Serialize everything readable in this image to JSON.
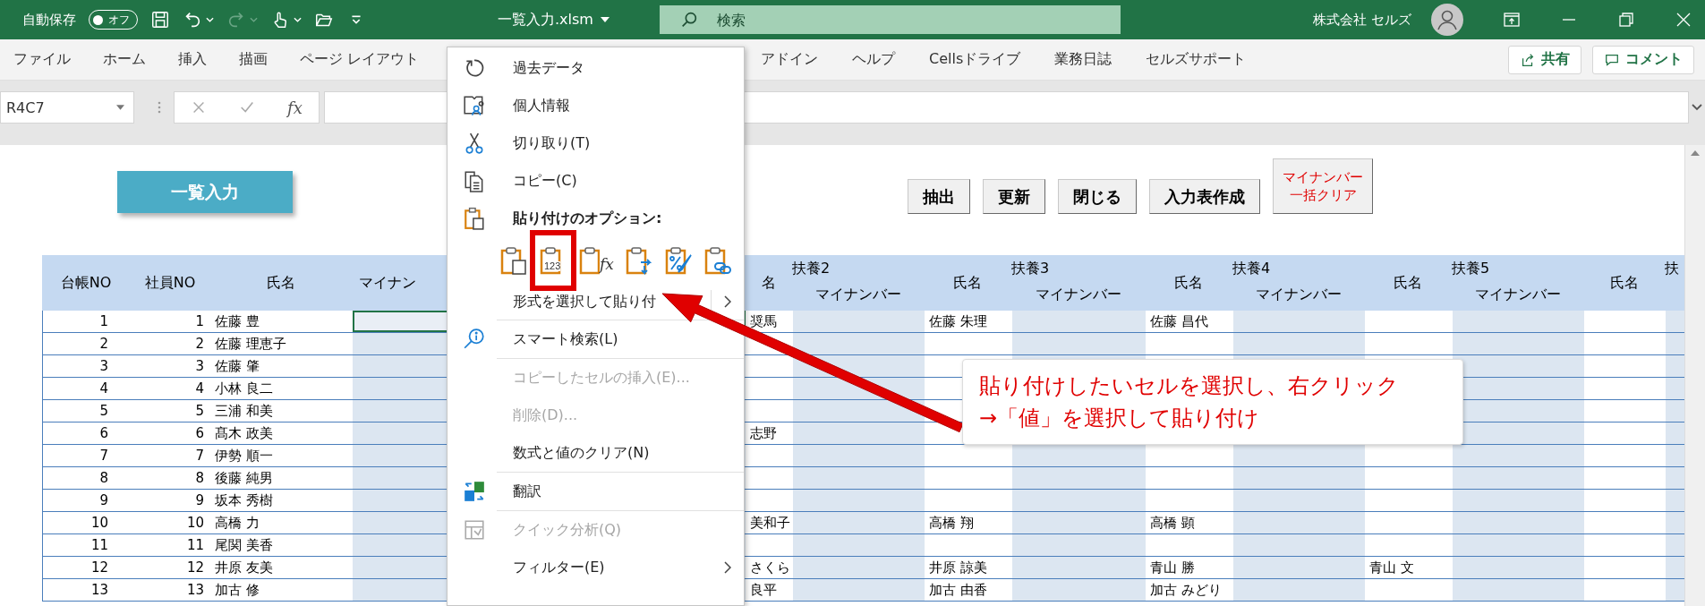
{
  "title_bar": {
    "autosave_label": "自動保存",
    "autosave": {
      "on": false,
      "label": "オフ"
    },
    "quick_access": [
      {
        "disabled": false
      },
      {
        "disabled": false
      },
      {
        "disabled": true
      },
      {
        "disabled": false
      },
      {
        "disabled": false
      },
      {
        "disabled": false
      }
    ],
    "file_name": "一覧入力.xlsm",
    "search": {
      "placeholder": "検索"
    },
    "account_name": "株式会社 セルズ"
  },
  "ribbon": {
    "tabs": [
      "ファイル",
      "ホーム",
      "挿入",
      "描画",
      "ページ レイアウト",
      "アドイン",
      "ヘルプ",
      "Cellsドライブ",
      "業務日誌",
      "セルズサポート"
    ],
    "share_button": "共有",
    "comment_button": "コメント"
  },
  "formula_bar": {
    "name_box": "R4C7",
    "fx_label": "fx"
  },
  "sheet": {
    "macro_button": "一覧入力",
    "buttons": [
      {
        "kind": "normal",
        "lines": [
          "抽出"
        ]
      },
      {
        "kind": "normal",
        "lines": [
          "更新"
        ]
      },
      {
        "kind": "normal",
        "lines": [
          "閉じる"
        ]
      },
      {
        "kind": "normal",
        "lines": [
          "入力表作成"
        ]
      },
      {
        "kind": "warning",
        "lines": [
          "マイナンバー",
          "一括クリア"
        ]
      }
    ],
    "table": {
      "columns": [
        {
          "kind": "ledger_no",
          "label": "台帳NO"
        },
        {
          "kind": "employee_no",
          "label": "社員NO"
        },
        {
          "kind": "name",
          "label": "氏名"
        },
        {
          "kind": "mynumber",
          "label": "マイナン"
        },
        {
          "kind": "dependent_name",
          "label": "名"
        },
        {
          "kind": "mynumber",
          "group": "扶養2",
          "label": "マイナンバー"
        },
        {
          "kind": "dependent_name",
          "label": "氏名"
        },
        {
          "kind": "mynumber",
          "group": "扶養3",
          "label": "マイナンバー"
        },
        {
          "kind": "dependent_name",
          "label": "氏名"
        },
        {
          "kind": "mynumber",
          "group": "扶養4",
          "label": "マイナンバー"
        },
        {
          "kind": "dependent_name",
          "label": "氏名"
        },
        {
          "kind": "mynumber",
          "group": "扶養5",
          "label": "マイナンバー"
        },
        {
          "kind": "dependent_name",
          "label": "氏名"
        },
        {
          "kind": "mynumber",
          "group": "扶"
        }
      ],
      "rows": [
        {
          "ledger_no": "1",
          "employee_no": "1",
          "name": "佐藤 豊",
          "selected": true,
          "dependents": [
            {
              "name": "奨馬"
            },
            {
              "name": "佐藤 朱理"
            },
            {
              "name": "佐藤 昌代"
            }
          ]
        },
        {
          "ledger_no": "2",
          "employee_no": "2",
          "name": "佐藤 理恵子",
          "selected": false
        },
        {
          "ledger_no": "3",
          "employee_no": "3",
          "name": "佐藤 肇",
          "selected": false
        },
        {
          "ledger_no": "4",
          "employee_no": "4",
          "name": "小林 良二",
          "selected": false
        },
        {
          "ledger_no": "5",
          "employee_no": "5",
          "name": "三浦 和美",
          "selected": false
        },
        {
          "ledger_no": "6",
          "employee_no": "6",
          "name": "髙木 政美",
          "selected": false,
          "dependents": [
            {
              "name": "志野"
            }
          ]
        },
        {
          "ledger_no": "7",
          "employee_no": "7",
          "name": "伊勢 順一",
          "selected": false
        },
        {
          "ledger_no": "8",
          "employee_no": "8",
          "name": "後藤 純男",
          "selected": false
        },
        {
          "ledger_no": "9",
          "employee_no": "9",
          "name": "坂本 秀樹",
          "selected": false
        },
        {
          "ledger_no": "10",
          "employee_no": "10",
          "name": "高橋 力",
          "selected": false,
          "dependents": [
            {
              "name": "美和子"
            },
            {
              "name": "高橋 翔"
            },
            {
              "name": "高橋 顕"
            }
          ]
        },
        {
          "ledger_no": "11",
          "employee_no": "11",
          "name": "尾関 美香",
          "selected": false
        },
        {
          "ledger_no": "12",
          "employee_no": "12",
          "name": "井原 友美",
          "selected": false,
          "dependents": [
            {
              "name": "さくら"
            },
            {
              "name": "井原 諒美"
            },
            {
              "name": "青山 勝"
            },
            {
              "name": "青山 文"
            }
          ]
        },
        {
          "ledger_no": "13",
          "employee_no": "13",
          "name": "加古 修",
          "selected": false,
          "dependents": [
            {
              "name": "良平"
            },
            {
              "name": "加古 由香"
            },
            {
              "name": "加古 みどり"
            }
          ]
        }
      ]
    }
  },
  "context_menu": {
    "items": [
      {
        "kind": "command",
        "label": "過去データ",
        "disabled": false
      },
      {
        "kind": "command",
        "label": "個人情報",
        "disabled": false
      },
      {
        "kind": "command",
        "label": "切り取り(T)",
        "disabled": false
      },
      {
        "kind": "command",
        "label": "コピー(C)",
        "disabled": false
      },
      {
        "kind": "heading",
        "label": "貼り付けのオプション:"
      },
      {
        "kind": "paste_options",
        "options": [
          {
            "highlighted": false
          },
          {
            "highlighted": true,
            "text": "123"
          },
          {
            "highlighted": false,
            "text": "fx"
          },
          {
            "highlighted": false
          },
          {
            "highlighted": false
          },
          {
            "highlighted": false
          }
        ]
      },
      {
        "kind": "command",
        "label": "形式を選択して貼り付",
        "disabled": false,
        "submenu": true
      },
      {
        "kind": "command",
        "label": "スマート検索(L)",
        "disabled": false,
        "separator_before": true
      },
      {
        "kind": "command",
        "label": "コピーしたセルの挿入(E)...",
        "disabled": true,
        "separator_before": true
      },
      {
        "kind": "command",
        "label": "削除(D)...",
        "disabled": true
      },
      {
        "kind": "command",
        "label": "数式と値のクリア(N)",
        "disabled": false
      },
      {
        "kind": "command",
        "label": "翻訳",
        "disabled": false,
        "separator_before": true
      },
      {
        "kind": "command",
        "label": "クイック分析(Q)",
        "disabled": true,
        "separator_before": true
      },
      {
        "kind": "command",
        "label": "フィルター(E)",
        "disabled": false,
        "submenu": true
      }
    ]
  },
  "callout": {
    "text": "貼り付けしたいセルを選択し、右クリック\n→「値」を選択して貼り付け"
  }
}
